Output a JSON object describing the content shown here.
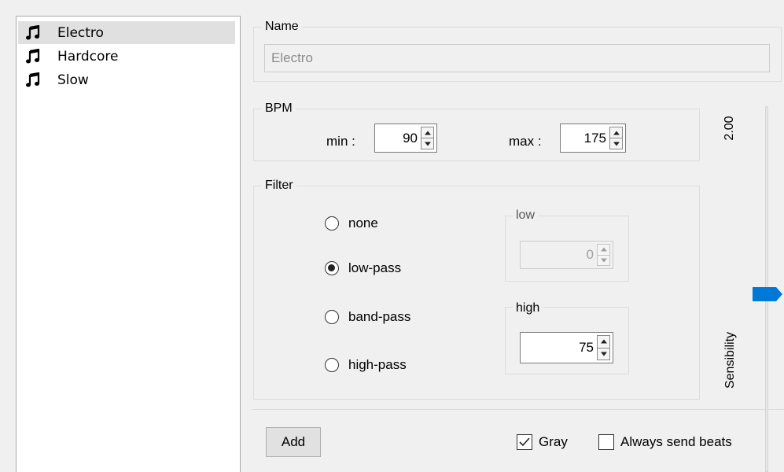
{
  "presets": {
    "items": [
      {
        "label": "Electro",
        "icon": "music-note-icon",
        "selected": true
      },
      {
        "label": "Hardcore",
        "icon": "music-note-icon",
        "selected": false
      },
      {
        "label": "Slow",
        "icon": "music-note-icon",
        "selected": false
      }
    ]
  },
  "name_group": {
    "title": "Name",
    "value": "Electro"
  },
  "bpm_group": {
    "title": "BPM",
    "min_label": "min :",
    "min_value": "90",
    "max_label": "max :",
    "max_value": "175"
  },
  "filter_group": {
    "title": "Filter",
    "options": [
      {
        "label": "none",
        "checked": false
      },
      {
        "label": "low-pass",
        "checked": true
      },
      {
        "label": "band-pass",
        "checked": false
      },
      {
        "label": "high-pass",
        "checked": false
      }
    ],
    "low": {
      "title": "low",
      "value": "0",
      "enabled": false
    },
    "high": {
      "title": "high",
      "value": "75",
      "enabled": true
    }
  },
  "sensibility": {
    "label": "Sensibility",
    "value_text": "2.00",
    "accent_color": "#0078d7"
  },
  "footer": {
    "add_label": "Add",
    "gray_label": "Gray",
    "gray_checked": true,
    "always_send_label": "Always send beats",
    "always_send_checked": false
  }
}
